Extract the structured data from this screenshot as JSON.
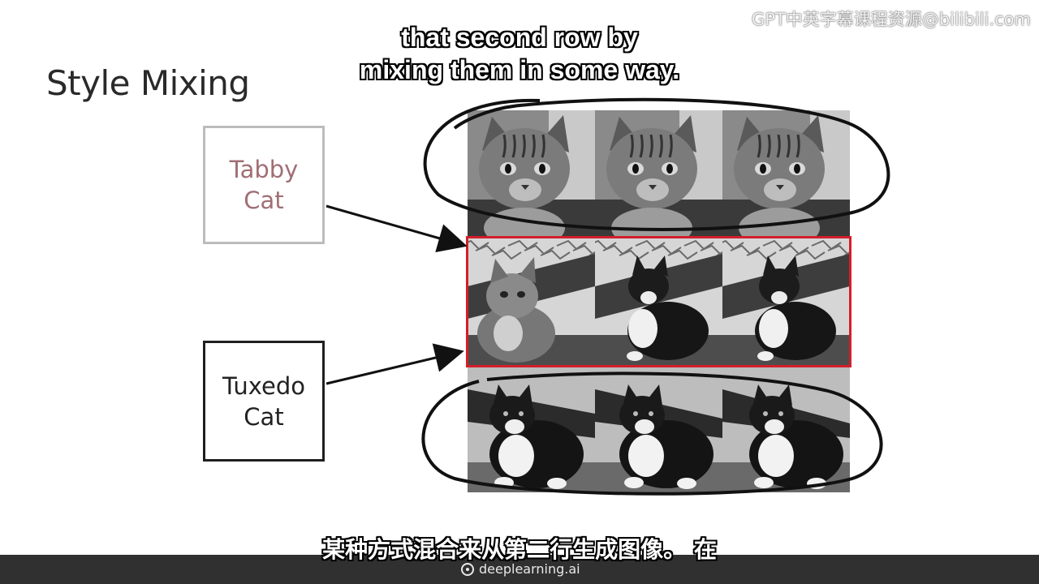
{
  "slide": {
    "title": "Style Mixing"
  },
  "labels": {
    "tabby": [
      "Tabby",
      "Cat"
    ],
    "tuxedo": [
      "Tuxedo",
      "Cat"
    ]
  },
  "captions": {
    "english": [
      "that second row by",
      "mixing them in some way."
    ],
    "chinese": "某种方式混合来从第二行生成图像。 在"
  },
  "watermark": "GPT中英字幕课程资源@bilibili.com",
  "brand": "deeplearning.ai",
  "grid": {
    "rows": [
      {
        "name": "tabby-row",
        "cells": [
          "tabby",
          "tabby",
          "tabby"
        ]
      },
      {
        "name": "mixed-row",
        "cells": [
          "tabby-mixed",
          "tuxedo-mixed",
          "tuxedo-mixed"
        ]
      },
      {
        "name": "tuxedo-row",
        "cells": [
          "tuxedo",
          "tuxedo",
          "tuxedo"
        ]
      }
    ]
  },
  "colors": {
    "highlight": "#d21f2a",
    "tabby_label": "#a06e74",
    "bottom_bar": "#303030"
  }
}
